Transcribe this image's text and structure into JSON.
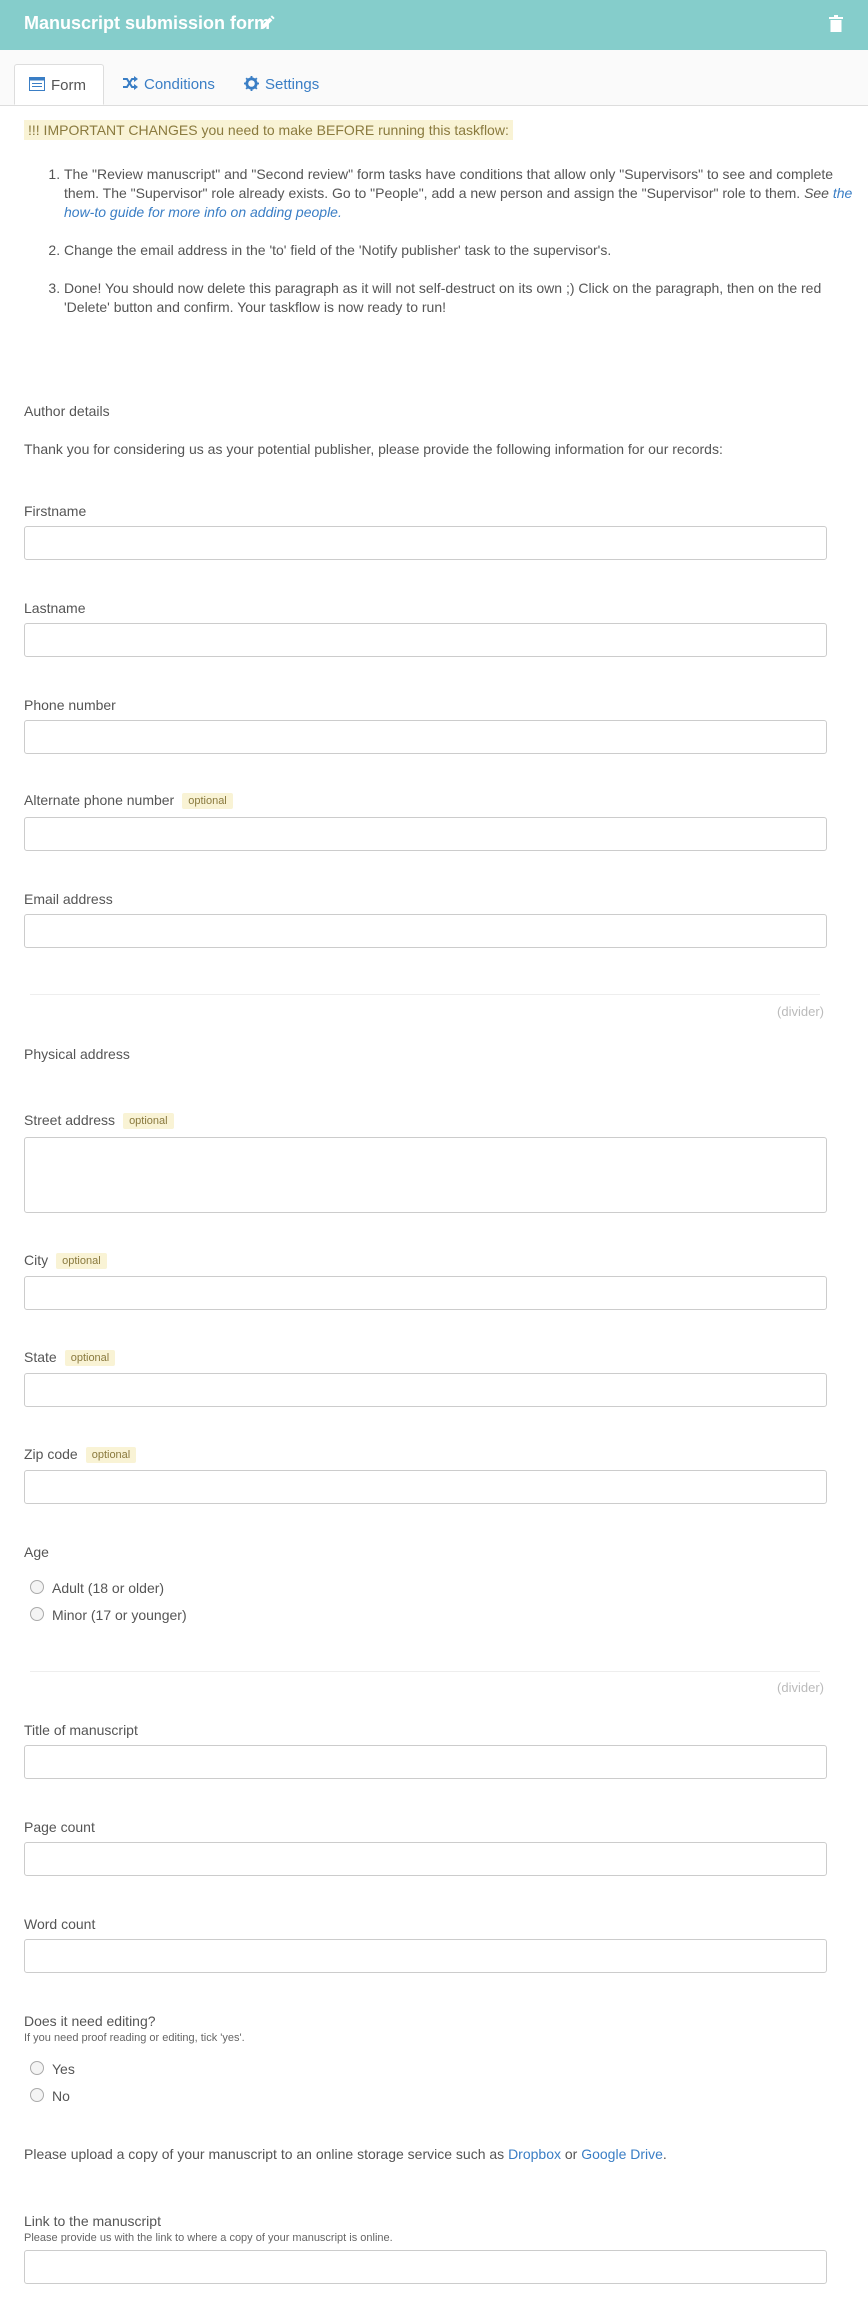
{
  "header": {
    "title": "Manuscript submission form"
  },
  "tabs": [
    {
      "label": "Form"
    },
    {
      "label": "Conditions"
    },
    {
      "label": "Settings"
    }
  ],
  "notice": "!!! IMPORTANT CHANGES you need to make BEFORE running this taskflow:",
  "steps": {
    "s1_text": "The \"Review manuscript\" and \"Second review\" form tasks have conditions that allow only \"Supervisors\" to see and complete them. The \"Supervisor\" role already exists. Go to \"People\", add a new person and assign the \"Supervisor\" role to them.",
    "s1_see": "See",
    "s1_link": "the how-to guide for more info on adding people.",
    "s2_text": "Change the email address in the 'to' field of the 'Notify publisher' task to the supervisor's.",
    "s3_text": "Done! You should now delete this paragraph as it will not self-destruct on its own ;) Click on the paragraph, then on the red 'Delete' button and confirm. Your taskflow is now ready to run!"
  },
  "author_heading": "Author details",
  "author_intro": "Thank you for considering us as your potential publisher, please provide the following information for our records:",
  "optional_badge": "optional",
  "fields": {
    "firstname": "Firstname",
    "lastname": "Lastname",
    "phone": "Phone number",
    "alt_phone": "Alternate phone number",
    "email": "Email address",
    "street": "Street address",
    "city": "City",
    "state": "State",
    "zip": "Zip code",
    "title": "Title of manuscript",
    "page_count": "Page count",
    "word_count": "Word count",
    "link": "Link to the manuscript"
  },
  "divider_label": "(divider)",
  "physical_heading": "Physical address",
  "age": {
    "label": "Age",
    "options": [
      "Adult (18 or older)",
      "Minor (17 or younger)"
    ]
  },
  "editing": {
    "label": "Does it need editing?",
    "help": "If you need proof reading or editing, tick 'yes'.",
    "options": [
      "Yes",
      "No"
    ]
  },
  "upload": {
    "text_before": "Please upload a copy of your manuscript to an online storage service such as",
    "dropbox": "Dropbox",
    "or": "or",
    "gdrive": "Google Drive",
    "end": "."
  },
  "link_help": "Please provide us with the link to where a copy of your manuscript is online.",
  "colors": {
    "header": "#85cdcb",
    "link": "#3a7ec5",
    "badge_bg": "#f9f3d5"
  }
}
